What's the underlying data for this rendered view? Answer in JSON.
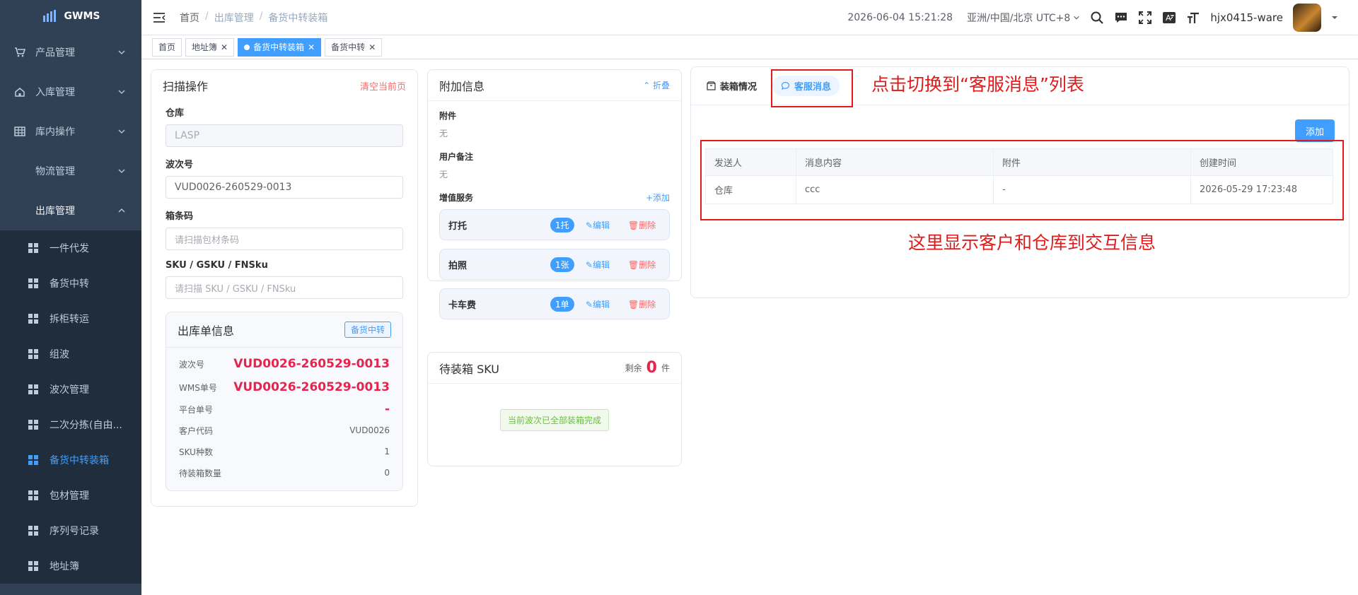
{
  "app": {
    "name": "GWMS"
  },
  "sidebar": {
    "menus": [
      {
        "label": "产品管理",
        "icon": "cart-icon"
      },
      {
        "label": "入库管理",
        "icon": "home-icon"
      },
      {
        "label": "库内操作",
        "icon": "table-icon"
      },
      {
        "label": "物流管理",
        "icon": "grid-icon"
      },
      {
        "label": "出库管理",
        "icon": "grid-icon",
        "expanded": true
      }
    ],
    "sub_items": [
      {
        "label": "一件代发"
      },
      {
        "label": "备货中转"
      },
      {
        "label": "拆柜转运"
      },
      {
        "label": "组波"
      },
      {
        "label": "波次管理"
      },
      {
        "label": "二次分拣(自由..."
      },
      {
        "label": "备货中转装箱",
        "active": true
      },
      {
        "label": "包材管理"
      },
      {
        "label": "序列号记录"
      },
      {
        "label": "地址簿"
      }
    ]
  },
  "navbar": {
    "breadcrumb": [
      "首页",
      "出库管理",
      "备货中转装箱"
    ],
    "datetime": "2026-06-04 15:21:28",
    "timezone": "亚洲/中国/北京 UTC+8",
    "username": "hjx0415-ware"
  },
  "tags": [
    {
      "label": "首页",
      "closable": false,
      "active": false
    },
    {
      "label": "地址簿",
      "closable": true,
      "active": false
    },
    {
      "label": "备货中转装箱",
      "closable": true,
      "active": true
    },
    {
      "label": "备货中转",
      "closable": true,
      "active": false
    }
  ],
  "scan": {
    "title": "扫描操作",
    "clear_label": "清空当前页",
    "warehouse_label": "仓库",
    "warehouse_value": "LASP",
    "wave_label": "波次号",
    "wave_value": "VUD0026-260529-0013",
    "box_label": "箱条码",
    "box_placeholder": "请扫描包材条码",
    "sku_label": "SKU / GSKU / FNSku",
    "sku_placeholder": "请扫描 SKU / GSKU / FNSku"
  },
  "outbound": {
    "title": "出库单信息",
    "tag": "备货中转",
    "rows": [
      {
        "label": "波次号",
        "value": "VUD0026-260529-0013"
      },
      {
        "label": "WMS单号",
        "value": "VUD0026-260529-0013"
      },
      {
        "label": "平台单号",
        "value": "-"
      },
      {
        "label": "客户代码",
        "value": "VUD0026"
      },
      {
        "label": "SKU种数",
        "value": "1"
      },
      {
        "label": "待装箱数量",
        "value": "0"
      }
    ]
  },
  "extra": {
    "title": "附加信息",
    "fold_label": "折叠",
    "attachment_label": "附件",
    "attachment_value": "无",
    "remark_label": "用户备注",
    "remark_value": "无",
    "services_label": "增值服务",
    "add_label": "+添加",
    "services": [
      {
        "name": "打托",
        "qty": "1托",
        "edit": "编辑",
        "delete": "删除"
      },
      {
        "name": "拍照",
        "qty": "1张",
        "edit": "编辑",
        "delete": "删除"
      },
      {
        "name": "卡车费",
        "qty": "1单",
        "edit": "编辑",
        "delete": "删除"
      }
    ]
  },
  "pending": {
    "title": "待装箱 SKU",
    "remain_label": "剩余",
    "remain_count": "0",
    "unit": "件",
    "empty_text": "当前波次已全部装箱完成"
  },
  "messages": {
    "tabs": [
      {
        "label": "装箱情况",
        "active": false
      },
      {
        "label": "客服消息",
        "active": true
      }
    ],
    "add_button": "添加",
    "columns": [
      "发送人",
      "消息内容",
      "附件",
      "创建时间"
    ],
    "rows": [
      [
        "仓库",
        "ccc",
        "-",
        "2026-05-29 17:23:48"
      ]
    ]
  },
  "annotations": {
    "tab_hint": "点击切换到“客服消息”列表",
    "table_hint": "这里显示客户和仓库到交互信息"
  },
  "colors": {
    "accent": "#409eff",
    "sidebar": "#304156",
    "annotation": "#e01b1b",
    "highlight": "#e6244d"
  }
}
